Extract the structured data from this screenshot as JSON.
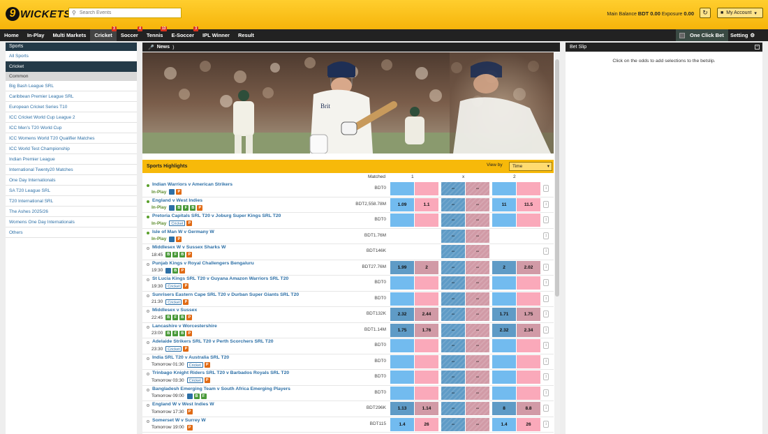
{
  "header": {
    "logo_mark": "9",
    "logo_text": "WICKETS",
    "search_placeholder": "Search Events",
    "main_balance_label": "Main Balance",
    "main_balance_value": "BDT 0.00",
    "exposure_label": "Exposure",
    "exposure_value": "0.00",
    "account_label": "My Account"
  },
  "nav": {
    "tabs": [
      {
        "label": "Home",
        "badge": ""
      },
      {
        "label": "In-Play",
        "badge": ""
      },
      {
        "label": "Multi Markets",
        "badge": ""
      },
      {
        "label": "Cricket",
        "badge": "3",
        "active": true
      },
      {
        "label": "Soccer",
        "badge": "4"
      },
      {
        "label": "Tennis",
        "badge": "13"
      },
      {
        "label": "E-Soccer",
        "badge": "3"
      },
      {
        "label": "IPL Winner",
        "badge": ""
      },
      {
        "label": "Result",
        "badge": ""
      }
    ],
    "one_click_bet": "One Click Bet",
    "setting": "Setting"
  },
  "left": {
    "heading": "Sports",
    "all_sports": "All Sports",
    "current": "Cricket",
    "group": "Common",
    "items": [
      "Big Bash League SRL",
      "Caribbean Premier League SRL",
      "European Cricket Series T10",
      "ICC Cricket World Cup League 2",
      "ICC Men's T20 World Cup",
      "ICC Womens World T20 Qualifier Matches",
      "ICC World Test Championship",
      "Indian Premier League",
      "International Twenty20 Matches",
      "One Day Internationals",
      "SA T20 League SRL",
      "T20 International SRL",
      "The Ashes 2025/26",
      "Womens One Day Internationals",
      "Others"
    ]
  },
  "news": {
    "label": "News"
  },
  "highlights": {
    "title": "Sports Highlights",
    "view_by_label": "View by",
    "view_by_value": "Time",
    "col_matched": "Matched",
    "col_1": "1",
    "col_x": "x",
    "col_2": "2"
  },
  "events": [
    {
      "name": "Indian Warriors v American Strikers",
      "time": "In-Play",
      "inplay": true,
      "icons": [
        "tv",
        "p"
      ],
      "matched": "BDT0",
      "odds": [
        "",
        "",
        "--",
        "--",
        "",
        ""
      ],
      "active": [
        true,
        true,
        true,
        true,
        true,
        true
      ]
    },
    {
      "name": "England v West Indies",
      "time": "In-Play",
      "inplay": true,
      "icons": [
        "tv",
        "b",
        "f",
        "b",
        "p"
      ],
      "matched": "BDT2,558.78M",
      "odds": [
        "1.09",
        "1.1",
        "--",
        "--",
        "11",
        "11.5"
      ],
      "active": [
        true,
        true,
        true,
        true,
        true,
        true
      ]
    },
    {
      "name": "Pretoria Capitals SRL T20 v Joburg Super Kings SRL T20",
      "time": "In-Play",
      "inplay": true,
      "icons": [
        "cricket",
        "p"
      ],
      "matched": "BDT0",
      "odds": [
        "",
        "",
        "--",
        "--",
        "",
        ""
      ],
      "active": [
        true,
        true,
        true,
        true,
        true,
        true
      ]
    },
    {
      "name": "Isle of Man W v Germany W",
      "time": "In-Play",
      "inplay": true,
      "icons": [
        "tv",
        "p"
      ],
      "matched": "BDT1.76M",
      "odds": [
        "",
        "",
        "--",
        "--",
        "",
        ""
      ],
      "active": [
        false,
        false,
        true,
        true,
        false,
        false
      ]
    },
    {
      "name": "Middlesex W v Sussex Sharks W",
      "time": "18:45",
      "inplay": false,
      "icons": [
        "b",
        "f",
        "b",
        "p"
      ],
      "matched": "BDT146K",
      "odds": [
        "",
        "",
        "--",
        "--",
        "",
        ""
      ],
      "active": [
        false,
        false,
        true,
        true,
        false,
        false
      ]
    },
    {
      "name": "Punjab Kings v Royal Challengers Bengaluru",
      "time": "19:30",
      "inplay": false,
      "icons": [
        "tv",
        "b",
        "p"
      ],
      "matched": "BDT27.76M",
      "odds": [
        "1.99",
        "2",
        "--",
        "--",
        "2",
        "2.02"
      ],
      "active": [
        true,
        true,
        true,
        true,
        true,
        true
      ]
    },
    {
      "name": "St Lucia Kings SRL T20 v Guyana Amazon Warriors SRL T20",
      "time": "19:30",
      "inplay": false,
      "icons": [
        "cricket",
        "p"
      ],
      "matched": "BDT0",
      "odds": [
        "",
        "",
        "--",
        "--",
        "",
        ""
      ],
      "active": [
        true,
        true,
        true,
        true,
        true,
        true
      ]
    },
    {
      "name": "Sunrisers Eastern Cape SRL T20 v Durban Super Giants SRL T20",
      "time": "21:30",
      "inplay": false,
      "icons": [
        "cricket",
        "p"
      ],
      "matched": "BDT0",
      "odds": [
        "",
        "",
        "--",
        "--",
        "",
        ""
      ],
      "active": [
        true,
        true,
        true,
        true,
        true,
        true
      ]
    },
    {
      "name": "Middlesex v Sussex",
      "time": "22:45",
      "inplay": false,
      "icons": [
        "b",
        "f",
        "b",
        "p"
      ],
      "matched": "BDT132K",
      "odds": [
        "2.32",
        "2.44",
        "--",
        "--",
        "1.71",
        "1.75"
      ],
      "active": [
        true,
        true,
        true,
        true,
        true,
        true
      ]
    },
    {
      "name": "Lancashire v Worcestershire",
      "time": "23:00",
      "inplay": false,
      "icons": [
        "b",
        "f",
        "b",
        "p"
      ],
      "matched": "BDT1.14M",
      "odds": [
        "1.75",
        "1.76",
        "--",
        "--",
        "2.32",
        "2.34"
      ],
      "active": [
        true,
        true,
        true,
        true,
        true,
        true
      ]
    },
    {
      "name": "Adelaide Strikers SRL T20 v Perth Scorchers SRL T20",
      "time": "23:30",
      "inplay": false,
      "icons": [
        "cricket",
        "p"
      ],
      "matched": "BDT0",
      "odds": [
        "",
        "",
        "--",
        "--",
        "",
        ""
      ],
      "active": [
        true,
        true,
        true,
        true,
        true,
        true
      ]
    },
    {
      "name": "India SRL T20 v Australia SRL T20",
      "time": "Tomorrow 01:30",
      "inplay": false,
      "icons": [
        "cricket",
        "p"
      ],
      "matched": "BDT0",
      "odds": [
        "",
        "",
        "--",
        "--",
        "",
        ""
      ],
      "active": [
        true,
        true,
        true,
        true,
        true,
        true
      ]
    },
    {
      "name": "Trinbago Knight Riders SRL T20 v Barbados Royals SRL T20",
      "time": "Tomorrow 03:30",
      "inplay": false,
      "icons": [
        "cricket",
        "p"
      ],
      "matched": "BDT0",
      "odds": [
        "",
        "",
        "--",
        "--",
        "",
        ""
      ],
      "active": [
        true,
        true,
        true,
        true,
        true,
        true
      ]
    },
    {
      "name": "Bangladesh Emerging Team v South Africa Emerging Players",
      "time": "Tomorrow 09:00",
      "inplay": false,
      "icons": [
        "tv",
        "b",
        "f"
      ],
      "matched": "BDT0",
      "odds": [
        "",
        "",
        "--",
        "--",
        "",
        ""
      ],
      "active": [
        true,
        true,
        true,
        true,
        true,
        true
      ]
    },
    {
      "name": "England W v West Indies W",
      "time": "Tomorrow 17:30",
      "inplay": false,
      "icons": [
        "p"
      ],
      "matched": "BDT296K",
      "odds": [
        "1.13",
        "1.14",
        "--",
        "--",
        "8",
        "8.8"
      ],
      "active": [
        true,
        true,
        true,
        true,
        true,
        true
      ]
    },
    {
      "name": "Somerset W v Surrey W",
      "time": "Tomorrow 19:00",
      "inplay": false,
      "icons": [
        "p"
      ],
      "matched": "BDT115",
      "odds": [
        "1.4",
        "26",
        "--",
        "--",
        "1.4",
        "26"
      ],
      "active": [
        true,
        true,
        true,
        true,
        true,
        true
      ]
    }
  ],
  "icon_labels": {
    "tv": "",
    "b": "B",
    "f": "F",
    "p": "P",
    "cricket": "Cricket"
  },
  "betslip": {
    "title": "Bet Slip",
    "empty": "Click on the odds to add selections to the betslip."
  },
  "colors": {
    "brand_yellow": "#f7b90a",
    "dark": "#222222",
    "back": "#72bbef",
    "lay": "#faa9ba",
    "link": "#2c6fa6"
  }
}
